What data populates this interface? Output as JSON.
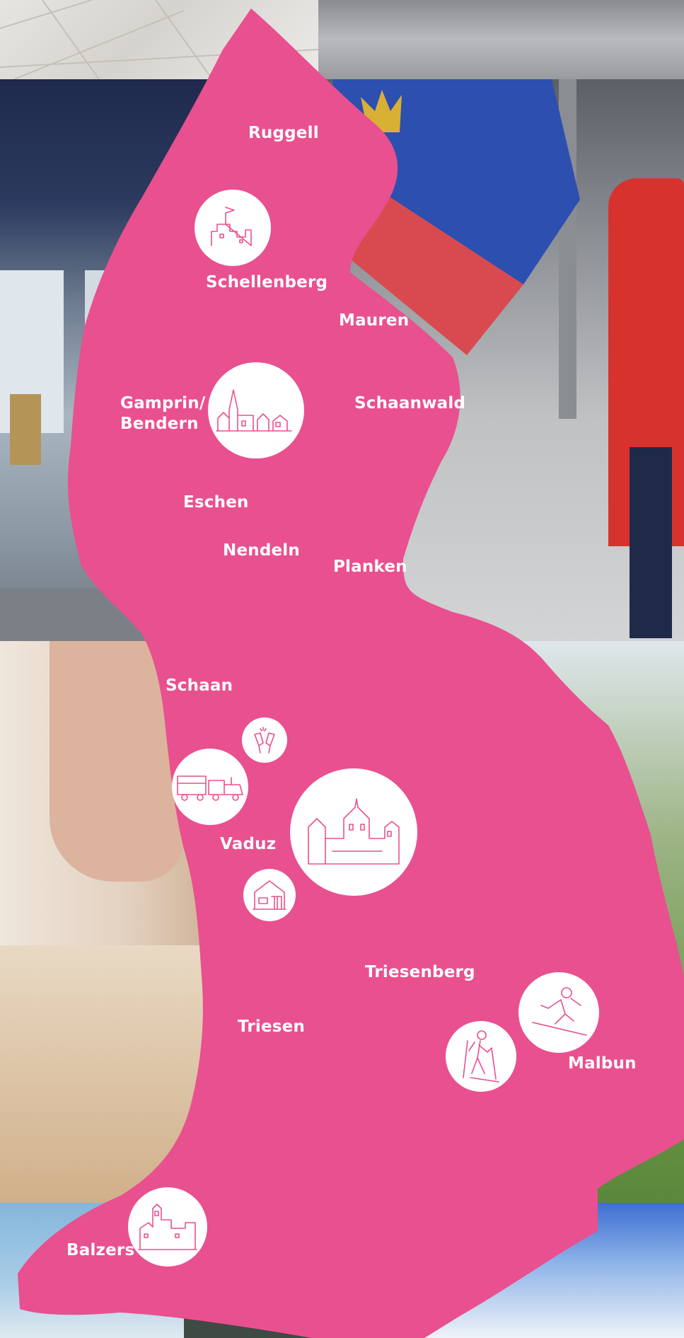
{
  "map": {
    "region_color": "#e9508f",
    "towns": [
      {
        "id": "ruggell",
        "label": "Ruggell"
      },
      {
        "id": "schellenberg",
        "label": "Schellenberg"
      },
      {
        "id": "mauren",
        "label": "Mauren"
      },
      {
        "id": "gamprin",
        "label": "Gamprin/\nBendern"
      },
      {
        "id": "schaanwald",
        "label": "Schaanwald"
      },
      {
        "id": "eschen",
        "label": "Eschen"
      },
      {
        "id": "nendeln",
        "label": "Nendeln"
      },
      {
        "id": "planken",
        "label": "Planken"
      },
      {
        "id": "schaan",
        "label": "Schaan"
      },
      {
        "id": "vaduz",
        "label": "Vaduz"
      },
      {
        "id": "triesenberg",
        "label": "Triesenberg"
      },
      {
        "id": "triesen",
        "label": "Triesen"
      },
      {
        "id": "malbun",
        "label": "Malbun"
      },
      {
        "id": "balzers",
        "label": "Balzers"
      }
    ],
    "icons": [
      {
        "id": "schellenberg",
        "icon": "castle-ruin-icon"
      },
      {
        "id": "gamprin",
        "icon": "village-church-icon"
      },
      {
        "id": "schaan-toast",
        "icon": "wine-toast-icon"
      },
      {
        "id": "schaan-train",
        "icon": "tourist-train-icon"
      },
      {
        "id": "vaduz-castle",
        "icon": "vaduz-castle-icon"
      },
      {
        "id": "vaduz-house",
        "icon": "museum-house-icon"
      },
      {
        "id": "malbun-ski",
        "icon": "skier-icon"
      },
      {
        "id": "malbun-hike",
        "icon": "hiker-icon"
      },
      {
        "id": "balzers",
        "icon": "gutenberg-castle-icon"
      }
    ]
  },
  "photos": [
    {
      "id": "tiles",
      "subject": "stone-tiles-photo"
    },
    {
      "id": "street",
      "subject": "street-photo"
    },
    {
      "id": "building",
      "subject": "building-photo"
    },
    {
      "id": "flag",
      "subject": "flag-woman-photo"
    },
    {
      "id": "wine",
      "subject": "wine-tasting-photo"
    },
    {
      "id": "mountains",
      "subject": "mountain-meadow-photo"
    },
    {
      "id": "snow-left",
      "subject": "snowy-mountain-photo"
    },
    {
      "id": "snow-right",
      "subject": "snow-slope-photo"
    }
  ],
  "flag": {
    "top_color": "#2c4fb0",
    "bottom_color": "#d94a50",
    "crown_color": "#d8b034"
  }
}
